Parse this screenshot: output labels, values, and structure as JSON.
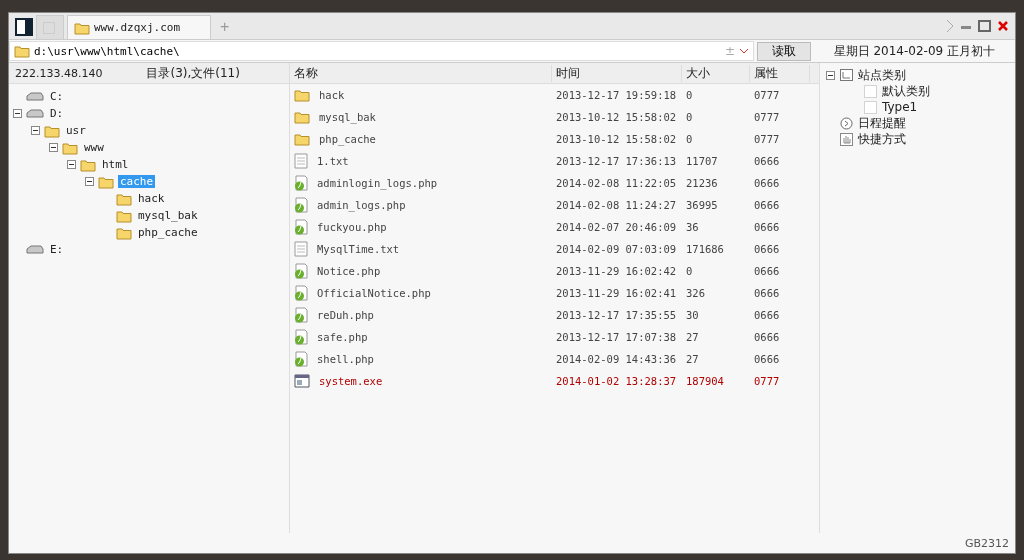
{
  "tabs": [
    {
      "kind": "blank",
      "selected": false
    },
    {
      "kind": "site",
      "label": "www.dzqxj.com",
      "selected": true
    }
  ],
  "new_tab": "+",
  "address": {
    "value": "d:\\usr\\www\\html\\cache\\",
    "plus_minus": "±",
    "button": "读取"
  },
  "date_line": "星期日 2014-02-09 正月初十",
  "left_panel": {
    "ip": "222.133.48.140",
    "summary": "目录(3),文件(11)",
    "tree": [
      {
        "kind": "drive",
        "label": "C:",
        "selected": false
      },
      {
        "kind": "drive",
        "label": "D:",
        "expanded": true,
        "selected": false,
        "children": [
          {
            "kind": "folder",
            "label": "usr",
            "expanded": true,
            "selected": false,
            "children": [
              {
                "kind": "folder",
                "label": "www",
                "expanded": true,
                "selected": false,
                "children": [
                  {
                    "kind": "folder",
                    "label": "html",
                    "expanded": true,
                    "selected": false,
                    "children": [
                      {
                        "kind": "folder",
                        "label": "cache",
                        "expanded": true,
                        "selected": true,
                        "children": [
                          {
                            "kind": "folder",
                            "label": "hack",
                            "selected": false
                          },
                          {
                            "kind": "folder",
                            "label": "mysql_bak",
                            "selected": false
                          },
                          {
                            "kind": "folder",
                            "label": "php_cache",
                            "selected": false
                          }
                        ]
                      }
                    ]
                  }
                ]
              }
            ]
          }
        ]
      },
      {
        "kind": "drive",
        "label": "E:",
        "selected": false
      }
    ]
  },
  "table": {
    "columns": [
      "名称",
      "时间",
      "大小",
      "属性"
    ],
    "rows": [
      {
        "kind": "folder",
        "name": "hack",
        "time": "2013-12-17 19:59:18",
        "size": "0",
        "attr": "0777",
        "highlighted": false
      },
      {
        "kind": "folder",
        "name": "mysql_bak",
        "time": "2013-10-12 15:58:02",
        "size": "0",
        "attr": "0777",
        "highlighted": false
      },
      {
        "kind": "folder",
        "name": "php_cache",
        "time": "2013-10-12 15:58:02",
        "size": "0",
        "attr": "0777",
        "highlighted": false
      },
      {
        "kind": "text",
        "name": "1.txt",
        "time": "2013-12-17 17:36:13",
        "size": "11707",
        "attr": "0666",
        "highlighted": false
      },
      {
        "kind": "php",
        "name": "adminlogin_logs.php",
        "time": "2014-02-08 11:22:05",
        "size": "21236",
        "attr": "0666",
        "highlighted": false
      },
      {
        "kind": "php",
        "name": "admin_logs.php",
        "time": "2014-02-08 11:24:27",
        "size": "36995",
        "attr": "0666",
        "highlighted": false
      },
      {
        "kind": "php",
        "name": "fuckyou.php",
        "time": "2014-02-07 20:46:09",
        "size": "36",
        "attr": "0666",
        "highlighted": false
      },
      {
        "kind": "text",
        "name": "MysqlTime.txt",
        "time": "2014-02-09 07:03:09",
        "size": "171686",
        "attr": "0666",
        "highlighted": false
      },
      {
        "kind": "php",
        "name": "Notice.php",
        "time": "2013-11-29 16:02:42",
        "size": "0",
        "attr": "0666",
        "highlighted": false
      },
      {
        "kind": "php",
        "name": "OfficialNotice.php",
        "time": "2013-11-29 16:02:41",
        "size": "326",
        "attr": "0666",
        "highlighted": false
      },
      {
        "kind": "php",
        "name": "reDuh.php",
        "time": "2013-12-17 17:35:55",
        "size": "30",
        "attr": "0666",
        "highlighted": false
      },
      {
        "kind": "php",
        "name": "safe.php",
        "time": "2013-12-17 17:07:38",
        "size": "27",
        "attr": "0666",
        "highlighted": false
      },
      {
        "kind": "php",
        "name": "shell.php",
        "time": "2014-02-09 14:43:36",
        "size": "27",
        "attr": "0666",
        "highlighted": false
      },
      {
        "kind": "exe",
        "name": "system.exe",
        "time": "2014-01-02 13:28:37",
        "size": "187904",
        "attr": "0777",
        "highlighted": true
      }
    ]
  },
  "right_tree": [
    {
      "kind": "category",
      "label": "站点类别",
      "expanded": true,
      "children": [
        {
          "kind": "item",
          "label": "默认类别"
        },
        {
          "kind": "item",
          "label": "Type1"
        }
      ]
    },
    {
      "kind": "schedule",
      "label": "日程提醒"
    },
    {
      "kind": "shortcut",
      "label": "快捷方式"
    }
  ],
  "status_bar": {
    "encoding": "GB2312"
  }
}
